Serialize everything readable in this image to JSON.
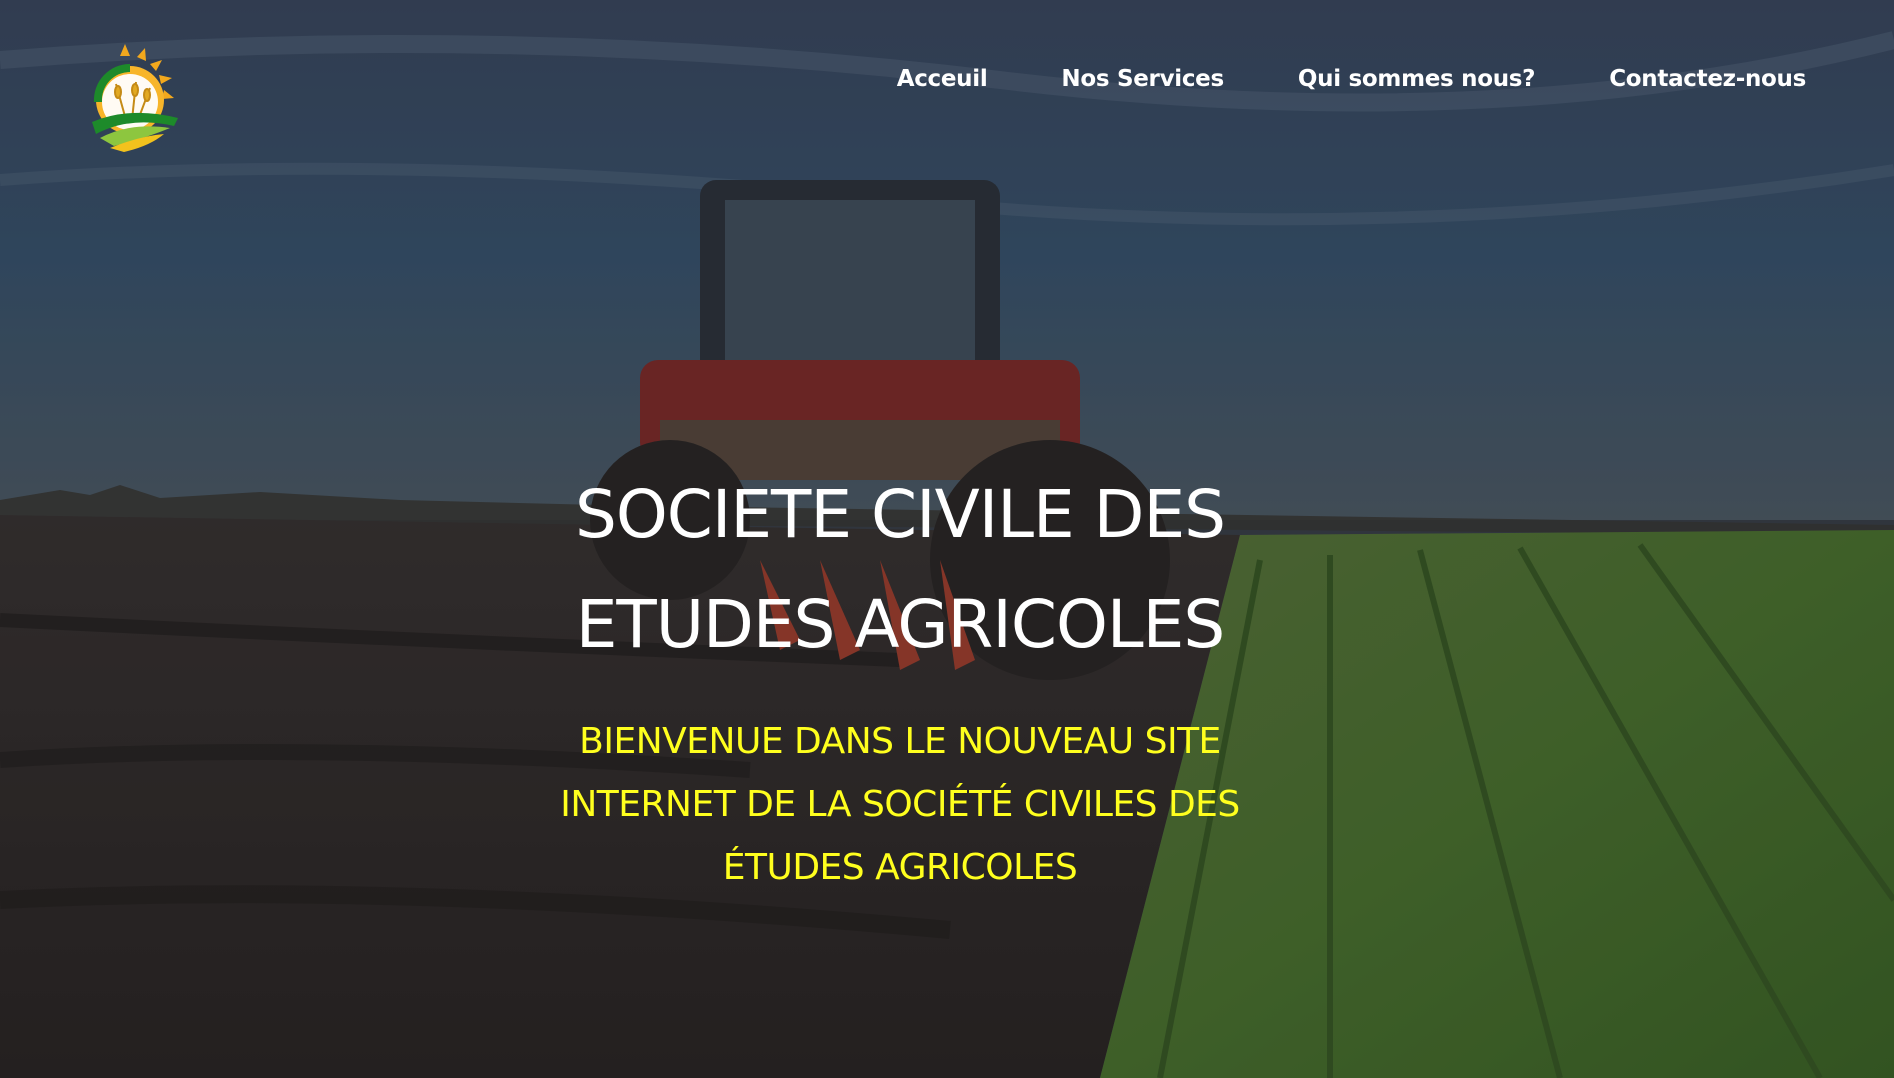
{
  "nav": {
    "links": [
      {
        "label": "Acceuil"
      },
      {
        "label": "Nos Services"
      },
      {
        "label": "Qui sommes nous?"
      },
      {
        "label": "Contactez-nous"
      }
    ]
  },
  "hero": {
    "title_line1": "SOCIETE CIVILE DES",
    "title_line2": "ETUDES AGRICOLES",
    "subtitle": "BIENVENUE DANS LE NOUVEAU SITE INTERNET DE LA SOCIÉTÉ CIVILES DES ÉTUDES AGRICOLES"
  },
  "colors": {
    "subtitle": "#ffff1e",
    "title": "#ffffff",
    "nav_text": "#ffffff"
  },
  "icons": {
    "logo": "sun-wheat-field-logo"
  }
}
